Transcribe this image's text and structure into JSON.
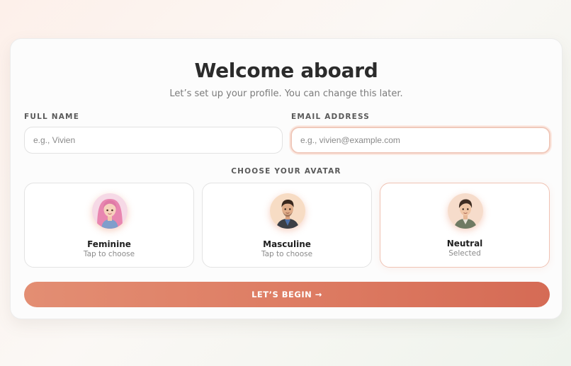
{
  "header": {
    "title": "Welcome aboard",
    "subtitle": "Let’s set up your profile. You can change this later."
  },
  "form": {
    "full_name": {
      "label": "FULL NAME",
      "value": "",
      "placeholder": "e.g., Vivien"
    },
    "email": {
      "label": "EMAIL ADDRESS",
      "value": "",
      "placeholder": "e.g., vivien@example.com",
      "focused": true
    }
  },
  "avatars": {
    "label": "CHOOSE YOUR AVATAR",
    "options": [
      {
        "name": "Feminine",
        "status": "Tap to choose",
        "selected": false,
        "icon": "feminine-avatar-icon"
      },
      {
        "name": "Masculine",
        "status": "Tap to choose",
        "selected": false,
        "icon": "masculine-avatar-icon"
      },
      {
        "name": "Neutral",
        "status": "Selected",
        "selected": true,
        "icon": "neutral-avatar-icon"
      }
    ]
  },
  "actions": {
    "begin_label": "LET’S BEGIN →"
  },
  "colors": {
    "accent": "#dd7b62",
    "selected_border": "#f0c3b4",
    "focus_border": "#f0c9bb"
  }
}
